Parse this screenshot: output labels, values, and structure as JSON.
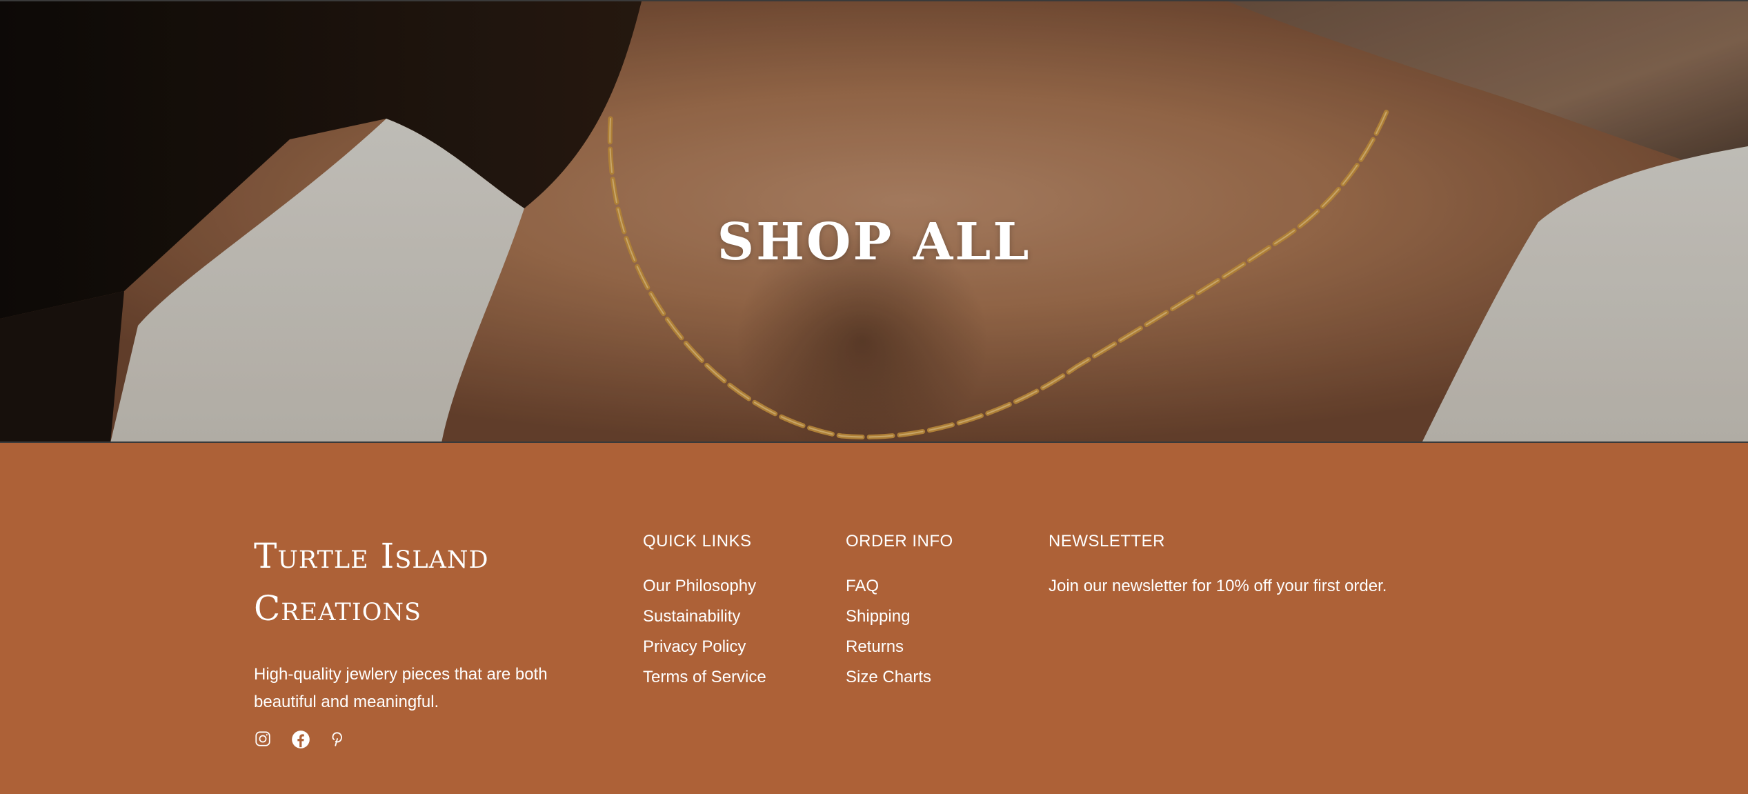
{
  "hero": {
    "title": "SHOP ALL"
  },
  "footer": {
    "brand": {
      "name_line1": "Turtle Island",
      "name_line2": "Creations",
      "description": "High-quality jewlery pieces that are both beautiful and meaningful."
    },
    "social": [
      "instagram-icon",
      "facebook-icon",
      "pinterest-icon"
    ],
    "quick_links": {
      "title": "QUICK LINKS",
      "items": [
        "Our Philosophy",
        "Sustainability",
        "Privacy Policy",
        "Terms of Service"
      ]
    },
    "order_info": {
      "title": "ORDER INFO",
      "items": [
        "FAQ",
        "Shipping",
        "Returns",
        "Size Charts"
      ]
    },
    "newsletter": {
      "title": "NEWSLETTER",
      "text": "Join our newsletter for 10% off your first order."
    }
  },
  "colors": {
    "footer_bg": "#ad6137",
    "text": "#ffffff"
  }
}
